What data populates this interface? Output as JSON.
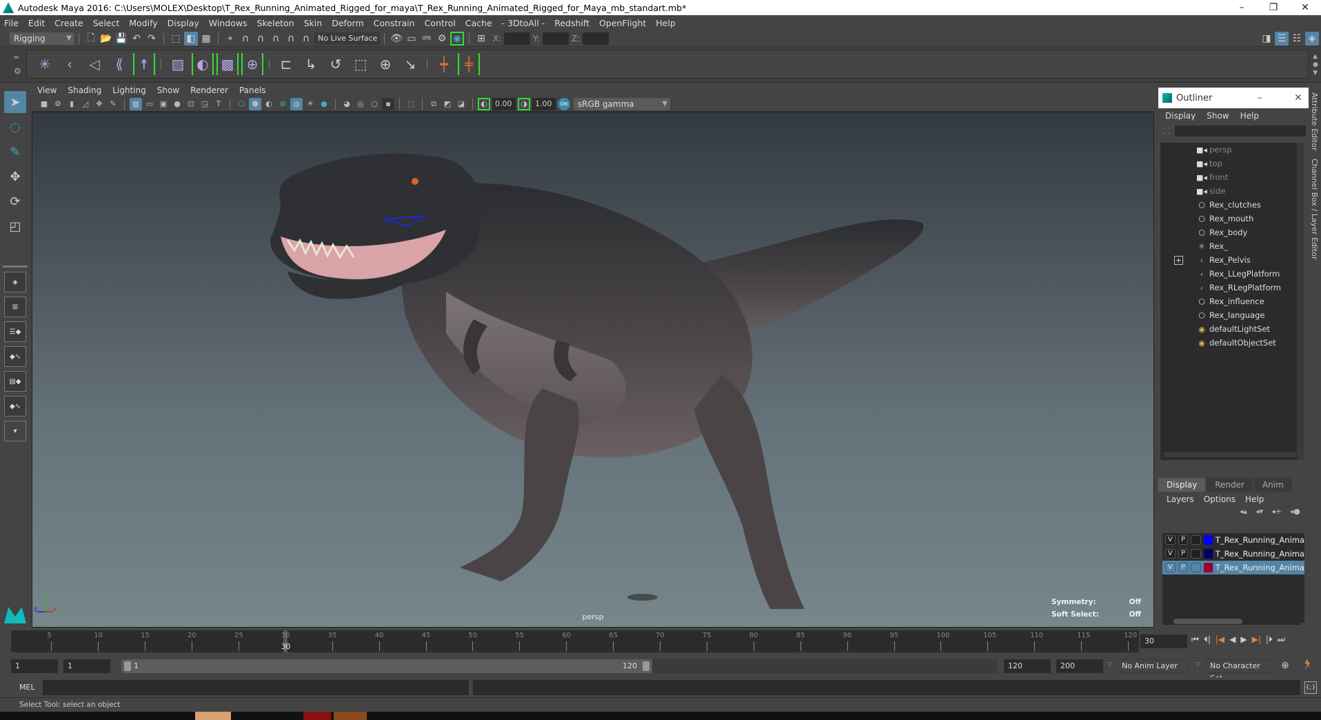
{
  "window": {
    "title": "Autodesk Maya 2016: C:\\Users\\MOLEX\\Desktop\\T_Rex_Running_Animated_Rigged_for_maya\\T_Rex_Running_Animated_Rigged_for_Maya_mb_standart.mb*",
    "controls": [
      "–",
      "❐",
      "✕"
    ]
  },
  "menubar": [
    "File",
    "Edit",
    "Create",
    "Select",
    "Modify",
    "Display",
    "Windows",
    "Skeleton",
    "Skin",
    "Deform",
    "Constrain",
    "Control",
    "Cache",
    "- 3DtoAll -",
    "Redshift",
    "OpenFlight",
    "Help"
  ],
  "statusline": {
    "menuset": "Rigging",
    "live_surface": "No Live Surface",
    "x_label": "X:",
    "y_label": "Y:",
    "z_label": "Z:",
    "x_value": "",
    "y_value": "",
    "z_value": ""
  },
  "shelf": {
    "icons": [
      "joint-tool",
      "ik-handle",
      "ik-spline",
      "insert-joint",
      "quick-rig",
      "paint-skin-weights",
      "bind-skin",
      "lattice",
      "cluster",
      "parent-constraint",
      "point-constraint",
      "orient-constraint",
      "scale-constraint",
      "aim-constraint",
      "pole-vector",
      "parent",
      "create-character"
    ]
  },
  "toolbox": {
    "tools": [
      "select-tool",
      "lasso-tool",
      "paint-select-tool",
      "move-tool",
      "rotate-tool",
      "scale-tool"
    ],
    "layouts": [
      "single-pane",
      "four-pane",
      "outliner-persp",
      "graph-persp",
      "hypershade-persp",
      "graph-outliner-persp"
    ]
  },
  "viewport": {
    "menu": [
      "View",
      "Shading",
      "Lighting",
      "Show",
      "Renderer",
      "Panels"
    ],
    "exposure": "0.00",
    "gamma": "1.00",
    "color_space": "sRGB gamma",
    "camera": "persp",
    "hud": [
      {
        "label": "Symmetry:",
        "value": "Off"
      },
      {
        "label": "Soft Select:",
        "value": "Off"
      }
    ],
    "axes": {
      "x": "x",
      "y": "y",
      "z": "z"
    }
  },
  "outliner": {
    "title": "Outliner",
    "menu": [
      "Display",
      "Show",
      "Help"
    ],
    "search_value": "",
    "items": [
      {
        "label": "persp",
        "icon": "camera-icon",
        "dim": true
      },
      {
        "label": "top",
        "icon": "camera-icon",
        "dim": true
      },
      {
        "label": "front",
        "icon": "camera-icon",
        "dim": true
      },
      {
        "label": "side",
        "icon": "camera-icon",
        "dim": true
      },
      {
        "label": "Rex_clutches",
        "icon": "mesh-icon"
      },
      {
        "label": "Rex_mouth",
        "icon": "mesh-icon"
      },
      {
        "label": "Rex_body",
        "icon": "mesh-icon"
      },
      {
        "label": "Rex_",
        "icon": "locator-icon"
      },
      {
        "label": "Rex_Pelvis",
        "icon": "joint-icon",
        "expandable": true
      },
      {
        "label": "Rex_LLegPlatform",
        "icon": "joint-icon"
      },
      {
        "label": "Rex_RLegPlatform",
        "icon": "joint-icon"
      },
      {
        "label": "Rex_influence",
        "icon": "mesh-icon"
      },
      {
        "label": "Rex_language",
        "icon": "mesh-icon"
      },
      {
        "label": "defaultLightSet",
        "icon": "set-icon"
      },
      {
        "label": "defaultObjectSet",
        "icon": "set-icon"
      }
    ]
  },
  "side_tabs": [
    "Attribute Editor",
    "Channel Box / Layer Editor"
  ],
  "layer_editor": {
    "tabs": [
      "Display",
      "Render",
      "Anim"
    ],
    "active_tab": "Display",
    "menu": [
      "Layers",
      "Options",
      "Help"
    ],
    "layers": [
      {
        "v": "V",
        "p": "P",
        "color": "#0000ff",
        "name": "T_Rex_Running_Anima",
        "selected": false
      },
      {
        "v": "V",
        "p": "P",
        "color": "#000066",
        "name": "T_Rex_Running_Anima",
        "selected": false
      },
      {
        "v": "V",
        "p": "P",
        "color": "#990033",
        "name": "T_Rex_Running_Anima",
        "selected": true
      }
    ]
  },
  "timeline": {
    "start": 1,
    "end": 120,
    "ticks": [
      5,
      10,
      15,
      20,
      25,
      30,
      35,
      40,
      45,
      50,
      55,
      60,
      65,
      70,
      75,
      80,
      85,
      90,
      95,
      100,
      105,
      110,
      115,
      120
    ],
    "current_frame": 30,
    "current_frame_field": "30",
    "playback_controls": [
      "go-to-start",
      "step-back-frame",
      "step-back-key",
      "play-backward",
      "play-forward",
      "step-forward-key",
      "step-forward-frame",
      "go-to-end"
    ]
  },
  "range": {
    "start_time": "1",
    "playback_start": "1",
    "slider_start_label": "1",
    "slider_end_label": "120",
    "playback_end": "120",
    "end_time": "200",
    "anim_layer": "No Anim Layer",
    "character_set": "No Character Set"
  },
  "command_line": {
    "label": "MEL",
    "value": ""
  },
  "help_line": "Select Tool: select an object",
  "colors": {
    "accent": "#5285a6",
    "panel": "#444444",
    "field": "#2b2b2b"
  }
}
